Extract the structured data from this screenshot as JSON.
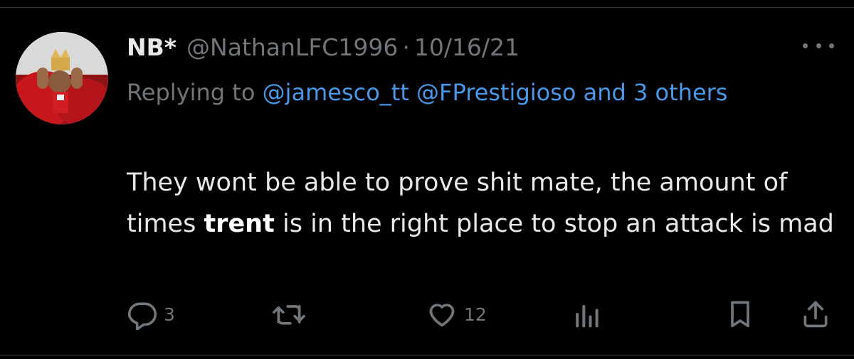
{
  "tweet": {
    "display_name": "NB*",
    "handle": "@NathanLFC1996",
    "separator": "·",
    "date": "10/16/21",
    "reply_prefix": "Replying to",
    "reply_mention_1": "@jamesco_tt",
    "reply_mention_2": "@FPrestigioso",
    "reply_and_others": "and 3 others",
    "body_part1": "They wont be able to prove shit mate, the amount of times",
    "body_bold": "trent",
    "body_part2": "is in the right place to stop an attack is mad",
    "reply_count": "3",
    "like_count": "12",
    "colors": {
      "background": "#000000",
      "primary_text": "#e7e9ea",
      "secondary_text": "#71767b",
      "link": "#4a99e9"
    },
    "icons": {
      "reply": "reply-icon",
      "retweet": "retweet-icon",
      "like": "heart-icon",
      "views": "views-icon",
      "bookmark": "bookmark-icon",
      "share": "share-icon",
      "more": "more-icon"
    }
  }
}
